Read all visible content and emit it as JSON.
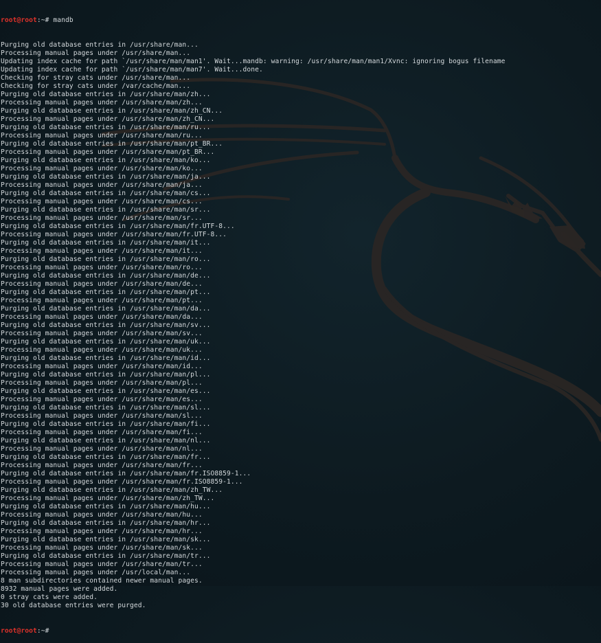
{
  "prompt": {
    "user_host": "root@root",
    "path": ":~# "
  },
  "command": "mandb",
  "output": [
    "Purging old database entries in /usr/share/man...",
    "Processing manual pages under /usr/share/man...",
    "Updating index cache for path `/usr/share/man/man1'. Wait...mandb: warning: /usr/share/man/man1/Xvnc: ignoring bogus filename",
    "Updating index cache for path `/usr/share/man/man7'. Wait...done.",
    "Checking for stray cats under /usr/share/man...",
    "Checking for stray cats under /var/cache/man...",
    "Purging old database entries in /usr/share/man/zh...",
    "Processing manual pages under /usr/share/man/zh...",
    "Purging old database entries in /usr/share/man/zh_CN...",
    "Processing manual pages under /usr/share/man/zh_CN...",
    "Purging old database entries in /usr/share/man/ru...",
    "Processing manual pages under /usr/share/man/ru...",
    "Purging old database entries in /usr/share/man/pt_BR...",
    "Processing manual pages under /usr/share/man/pt_BR...",
    "Purging old database entries in /usr/share/man/ko...",
    "Processing manual pages under /usr/share/man/ko...",
    "Purging old database entries in /usr/share/man/ja...",
    "Processing manual pages under /usr/share/man/ja...",
    "Purging old database entries in /usr/share/man/cs...",
    "Processing manual pages under /usr/share/man/cs...",
    "Purging old database entries in /usr/share/man/sr...",
    "Processing manual pages under /usr/share/man/sr...",
    "Purging old database entries in /usr/share/man/fr.UTF-8...",
    "Processing manual pages under /usr/share/man/fr.UTF-8...",
    "Purging old database entries in /usr/share/man/it...",
    "Processing manual pages under /usr/share/man/it...",
    "Purging old database entries in /usr/share/man/ro...",
    "Processing manual pages under /usr/share/man/ro...",
    "Purging old database entries in /usr/share/man/de...",
    "Processing manual pages under /usr/share/man/de...",
    "Purging old database entries in /usr/share/man/pt...",
    "Processing manual pages under /usr/share/man/pt...",
    "Purging old database entries in /usr/share/man/da...",
    "Processing manual pages under /usr/share/man/da...",
    "Purging old database entries in /usr/share/man/sv...",
    "Processing manual pages under /usr/share/man/sv...",
    "Purging old database entries in /usr/share/man/uk...",
    "Processing manual pages under /usr/share/man/uk...",
    "Purging old database entries in /usr/share/man/id...",
    "Processing manual pages under /usr/share/man/id...",
    "Purging old database entries in /usr/share/man/pl...",
    "Processing manual pages under /usr/share/man/pl...",
    "Purging old database entries in /usr/share/man/es...",
    "Processing manual pages under /usr/share/man/es...",
    "Purging old database entries in /usr/share/man/sl...",
    "Processing manual pages under /usr/share/man/sl...",
    "Purging old database entries in /usr/share/man/fi...",
    "Processing manual pages under /usr/share/man/fi...",
    "Purging old database entries in /usr/share/man/nl...",
    "Processing manual pages under /usr/share/man/nl...",
    "Purging old database entries in /usr/share/man/fr...",
    "Processing manual pages under /usr/share/man/fr...",
    "Purging old database entries in /usr/share/man/fr.ISO8859-1...",
    "Processing manual pages under /usr/share/man/fr.ISO8859-1...",
    "Purging old database entries in /usr/share/man/zh_TW...",
    "Processing manual pages under /usr/share/man/zh_TW...",
    "Purging old database entries in /usr/share/man/hu...",
    "Processing manual pages under /usr/share/man/hu...",
    "Purging old database entries in /usr/share/man/hr...",
    "Processing manual pages under /usr/share/man/hr...",
    "Purging old database entries in /usr/share/man/sk...",
    "Processing manual pages under /usr/share/man/sk...",
    "Purging old database entries in /usr/share/man/tr...",
    "Processing manual pages under /usr/share/man/tr...",
    "Processing manual pages under /usr/local/man...",
    "8 man subdirectories contained newer manual pages.",
    "8932 manual pages were added.",
    "0 stray cats were added.",
    "30 old database entries were purged."
  ],
  "colors": {
    "prompt_user": "#e0322a",
    "text": "#d4d9dc",
    "background": "#0d1a20"
  },
  "background_icon": "kali-dragon-icon"
}
